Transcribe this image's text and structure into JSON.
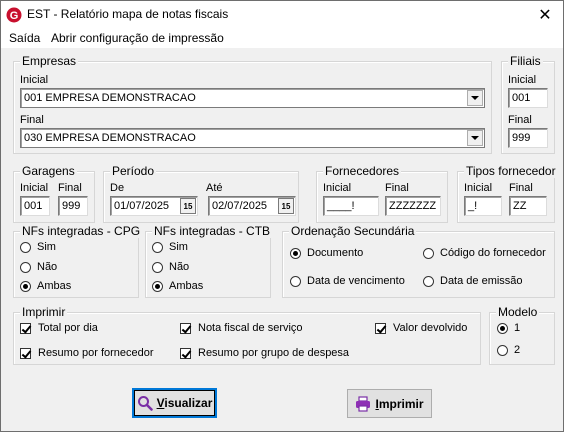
{
  "window": {
    "title": "EST - Relatório mapa de notas fiscais",
    "close_symbol": "✕"
  },
  "menu": [
    "Saída",
    "Abrir configuração de impressão"
  ],
  "empresas": {
    "legend": "Empresas",
    "inicial_label": "Inicial",
    "inicial_value": "001 EMPRESA DEMONSTRACAO",
    "final_label": "Final",
    "final_value": "030 EMPRESA DEMONSTRACAO"
  },
  "filiais": {
    "legend": "Filiais",
    "inicial_label": "Inicial",
    "inicial_value": "001",
    "final_label": "Final",
    "final_value": "999"
  },
  "garagens": {
    "legend": "Garagens",
    "inicial_label": "Inicial",
    "inicial_value": "001",
    "final_label": "Final",
    "final_value": "999"
  },
  "periodo": {
    "legend": "Período",
    "de_label": "De",
    "de_value": "01/07/2025",
    "ate_label": "Até",
    "ate_value": "02/07/2025",
    "cal_symbol": "15"
  },
  "fornecedores": {
    "legend": "Fornecedores",
    "inicial_label": "Inicial",
    "inicial_value": "____!",
    "final_label": "Final",
    "final_value": "ZZZZZZZ"
  },
  "tipos_fornecedor": {
    "legend": "Tipos fornecedor",
    "inicial_label": "Inicial",
    "inicial_value": "_!",
    "final_label": "Final",
    "final_value": "ZZ"
  },
  "nfs_cpg": {
    "legend": "NFs integradas - CPG",
    "options": [
      "Sim",
      "Não",
      "Ambas"
    ],
    "selected": "Ambas"
  },
  "nfs_ctb": {
    "legend": "NFs integradas - CTB",
    "options": [
      "Sim",
      "Não",
      "Ambas"
    ],
    "selected": "Ambas"
  },
  "ordenacao": {
    "legend": "Ordenação Secundária",
    "options": [
      "Documento",
      "Código do fornecedor",
      "Data de vencimento",
      "Data de emissão"
    ],
    "selected": "Documento"
  },
  "imprimir": {
    "legend": "Imprimir",
    "checks": [
      {
        "label": "Total por dia",
        "checked": true
      },
      {
        "label": "Nota fiscal de serviço",
        "checked": true
      },
      {
        "label": "Valor devolvido",
        "checked": true
      },
      {
        "label": "Resumo por fornecedor",
        "checked": true
      },
      {
        "label": "Resumo por grupo de despesa",
        "checked": true
      }
    ]
  },
  "modelo": {
    "legend": "Modelo",
    "options": [
      "1",
      "2"
    ],
    "selected": "1"
  },
  "buttons": {
    "visualizar_first": "V",
    "visualizar_rest": "isualizar",
    "imprimir_first": "I",
    "imprimir_rest": "mprimir"
  }
}
